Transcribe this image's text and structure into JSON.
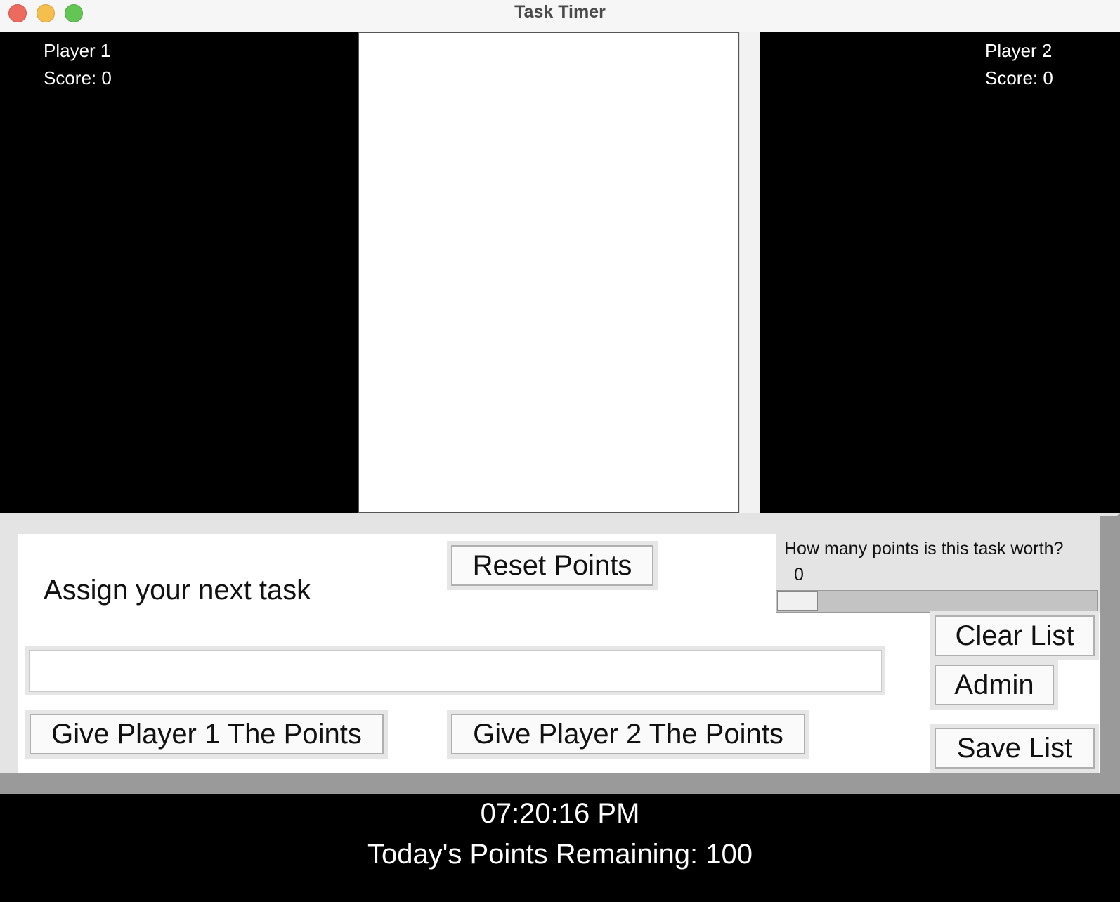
{
  "window": {
    "title": "Task Timer"
  },
  "player1": {
    "name": "Player 1",
    "score": "Score: 0"
  },
  "player2": {
    "name": "Player 2",
    "score": "Score: 0"
  },
  "controls": {
    "assign_label": "Assign your next task",
    "task_input_value": "",
    "reset_button": "Reset Points",
    "give_p1_button": "Give Player 1 The Points",
    "give_p2_button": "Give Player 2 The Points",
    "points_question": "How many points is this task worth?",
    "points_value": "0",
    "clear_list_button": "Clear List",
    "admin_button": "Admin",
    "save_list_button": "Save List"
  },
  "footer": {
    "clock": "07:20:16 PM",
    "remaining": "Today's Points Remaining: 100"
  },
  "colors": {
    "panel_bg": "#000000",
    "frame": "#e4e4e4",
    "bevel_dark": "#9a9a9a"
  }
}
